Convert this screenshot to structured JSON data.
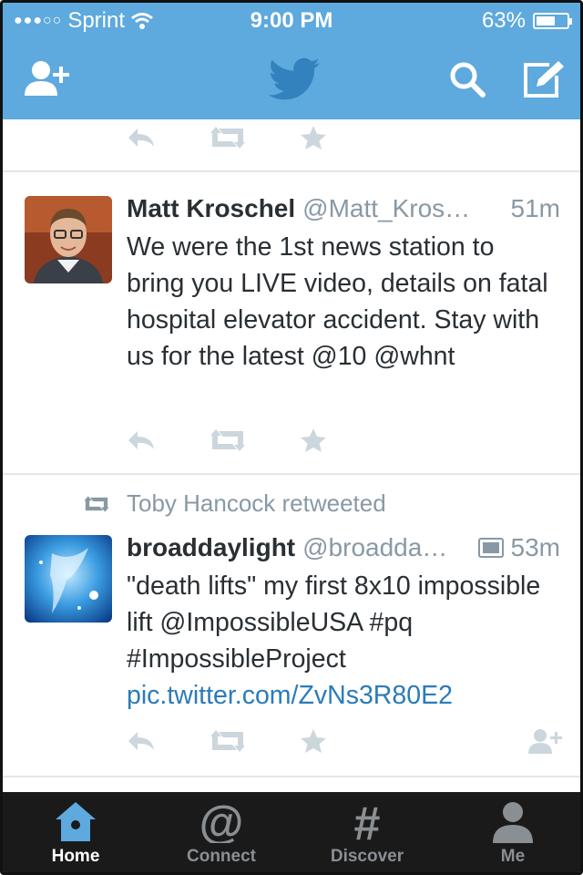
{
  "status_bar": {
    "carrier": "Sprint",
    "time": "9:00 PM",
    "battery": "63%",
    "battery_level": 0.63
  },
  "header": {
    "icons": [
      "add-user-icon",
      "twitter-bird-icon",
      "search-icon",
      "compose-icon"
    ]
  },
  "tweets": [
    {
      "name": "Matt Kroschel",
      "handle": "@Matt_Kros…",
      "time": "51m",
      "text": "We were the 1st news station to bring you LIVE video, details on fatal hospital elevator accident. Stay with us for the latest @10 @whnt"
    },
    {
      "retweeted_by": "Toby Hancock retweeted",
      "name": "broaddaylight",
      "handle": "@broadda…",
      "time": "53m",
      "text": "\"death lifts\" my first 8x10 impossible lift @ImpossibleUSA #pq #ImpossibleProject",
      "link": "pic.twitter.com/ZvNs3R80E2"
    }
  ],
  "tabs": [
    {
      "label": "Home",
      "icon": "home-icon",
      "active": true
    },
    {
      "label": "Connect",
      "icon": "at-icon",
      "active": false
    },
    {
      "label": "Discover",
      "icon": "hashtag-icon",
      "active": false
    },
    {
      "label": "Me",
      "icon": "person-icon",
      "active": false
    }
  ],
  "colors": {
    "brand": "#5ea9dd",
    "tabbar": "#1a1a1a",
    "link": "#2b7bb9",
    "muted": "#8899a6"
  }
}
